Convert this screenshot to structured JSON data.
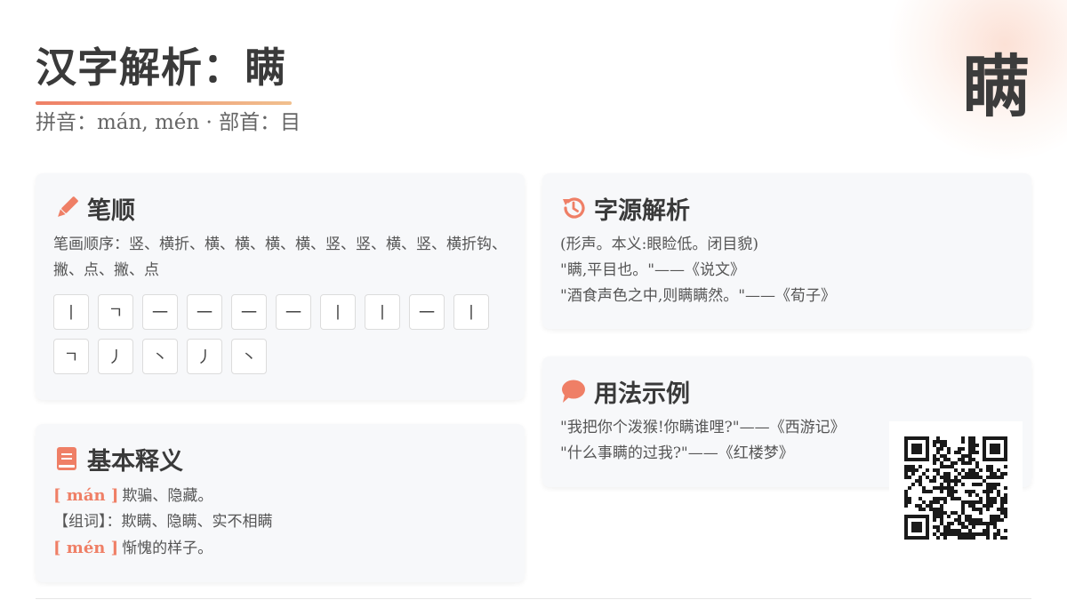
{
  "header": {
    "title": "汉字解析：瞒",
    "subtitle": "拼音：mán, mén · 部首：目",
    "big_char": "瞒"
  },
  "colors": {
    "accent": "#ef7f66",
    "accent_light": "#f1c08e"
  },
  "stroke_card": {
    "icon": "pencil-icon",
    "title": "笔顺",
    "order_text": "笔画顺序：竖、横折、横、横、横、横、竖、竖、横、竖、横折钩、撇、点、撇、点",
    "strokes": [
      "丨",
      "ㄱ",
      "一",
      "一",
      "一",
      "一",
      "丨",
      "丨",
      "一",
      "丨",
      "ㄱ",
      "丿",
      "丶",
      "丿",
      "丶"
    ]
  },
  "meaning_card": {
    "icon": "book-icon",
    "title": "基本释义",
    "entries": [
      {
        "pinyin": "[ mán ]",
        "text": "欺骗、隐藏。"
      },
      {
        "pinyin": "",
        "text": "【组词】：欺瞒、隐瞒、实不相瞒"
      },
      {
        "pinyin": "[ mén ]",
        "text": "惭愧的样子。"
      }
    ]
  },
  "origin_card": {
    "icon": "history-icon",
    "title": "字源解析",
    "lines": [
      "(形声。本义:眼睑低。闭目貌)",
      "\"瞒,平目也。\"——《说文》",
      "\"酒食声色之中,则瞒瞒然。\"——《荀子》"
    ]
  },
  "usage_card": {
    "icon": "speech-bubble-icon",
    "title": "用法示例",
    "lines": [
      "\"我把你个泼猴!你瞒谁哩?\"——《西游记》",
      "\"什么事瞒的过我?\"——《红楼梦》"
    ]
  },
  "qr": {
    "icon": "qr-code-icon"
  }
}
